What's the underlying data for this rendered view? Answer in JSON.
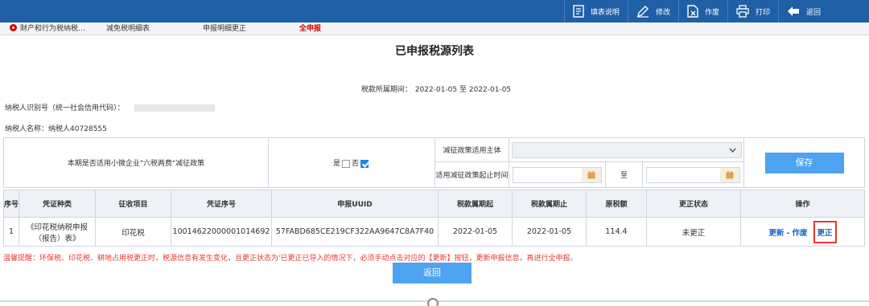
{
  "toolbar": {
    "items": [
      {
        "label": "填表说明",
        "icon": "document-icon"
      },
      {
        "label": "修改",
        "icon": "pencil-icon"
      },
      {
        "label": "作废",
        "icon": "void-doc-icon"
      },
      {
        "label": "打印",
        "icon": "printer-icon"
      },
      {
        "label": "返回",
        "icon": "back-arrow-icon"
      }
    ]
  },
  "tabs": [
    {
      "label": "财产和行为税纳税…",
      "active": false
    },
    {
      "label": "减免税明细表",
      "active": false
    },
    {
      "label": "申报明细更正",
      "active": false
    },
    {
      "label": "全申报",
      "active": true
    }
  ],
  "title": "已申报税源列表",
  "period": {
    "label": "税款所属期间：",
    "value": "2022-01-05 至 2022-01-05"
  },
  "taxpayer": {
    "id_label": "纳税人识别号（统一社会信用代码）：",
    "name_label": "纳税人名称：",
    "name_value": "纳税人40728555"
  },
  "policy": {
    "question": "本期是否适用小微企业\"六税两费\"减征政策",
    "yes_label": "是",
    "no_label": "否",
    "yes_checked": false,
    "no_checked": true,
    "subject_label": "减征政策适用主体",
    "period_label": "适用减征政策起止时间",
    "to_label": "至",
    "save_label": "保存"
  },
  "table": {
    "headers": [
      "序号",
      "凭证种类",
      "征收项目",
      "凭证序号",
      "申报UUID",
      "税款属期起",
      "税款属期止",
      "原税额",
      "更正状态",
      "操作"
    ],
    "rows": [
      {
        "index": "1",
        "voucher_type": "《印花税纳税申报（报告）表》",
        "item": "印花税",
        "voucher_no": "10014622000001014692",
        "uuid": "57FABD685CE219CF322AA9647C8A7F40",
        "start": "2022-01-05",
        "end": "2022-01-05",
        "amount": "114.4",
        "status": "未更正",
        "actions": {
          "update": "更新",
          "sep": "-",
          "void": "作废",
          "correct": "更正"
        }
      }
    ]
  },
  "tip": "温馨提醒：环保税、印花税、耕地占用税更正时，税源信息有发生变化，且更正状态为'已更正已导入的情况下，必须手动点击对应的【更新】按钮，更新申报信息，再进行全申报。",
  "back_label": "返回",
  "colors": {
    "toolbar": "#1f5fa6",
    "accent": "#4da3ef",
    "alert": "#e53935",
    "link": "#1565c0"
  }
}
